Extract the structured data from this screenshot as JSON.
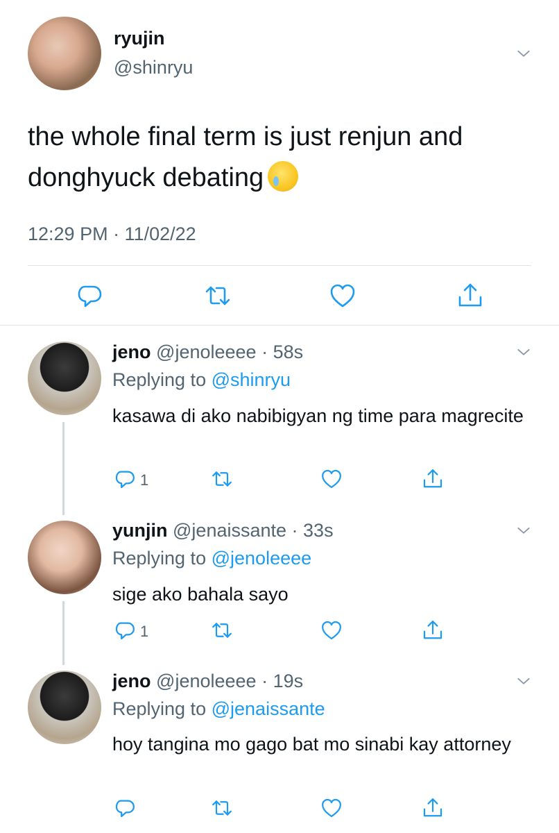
{
  "main_tweet": {
    "name": "ryujin",
    "handle": "@shinryu",
    "text": "the whole final term is just renjun and donghyuck debating",
    "emoji": "face-holding-back-tears-emoji",
    "timestamp": "12:29 PM · 11/02/22"
  },
  "replies": [
    {
      "name": "jeno",
      "handle": "@jenoleeee",
      "time": "· 58s",
      "replying_label": "Replying to",
      "replying_to": "@shinryu",
      "text": "kasawa di ako nabibigyan ng time para magrecite",
      "reply_count": "1"
    },
    {
      "name": "yunjin",
      "handle": "@jenaissante",
      "time": "· 33s",
      "replying_label": "Replying to",
      "replying_to": "@jenoleeee",
      "text": "sige ako bahala sayo",
      "reply_count": "1"
    },
    {
      "name": "jeno",
      "handle": "@jenoleeee",
      "time": "· 19s",
      "replying_label": "Replying to",
      "replying_to": "@jenaissante",
      "text": "hoy tangina mo gago bat mo sinabi kay attorney",
      "reply_count": ""
    }
  ],
  "colors": {
    "accent": "#1d9bf0",
    "secondary_text": "#536471",
    "icon": "#1d9bf0"
  }
}
